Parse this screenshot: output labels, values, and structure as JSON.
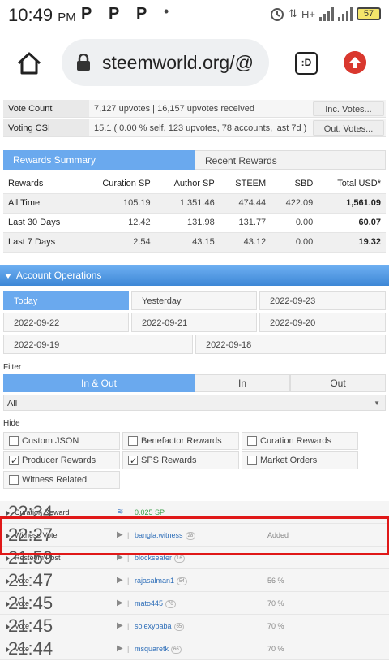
{
  "status_bar": {
    "time": "10:49",
    "ampm": "PM",
    "notif_icons": [
      "P",
      "P",
      "P"
    ],
    "net": "H+",
    "battery": "57"
  },
  "browser": {
    "url": "steemworld.org/@",
    "tabs_label": ":D"
  },
  "vote_count": {
    "label": "Vote Count",
    "value": "7,127 upvotes  |  16,157 upvotes received",
    "button": "Inc. Votes..."
  },
  "voting_csi": {
    "label": "Voting CSI",
    "value": "15.1 ( 0.00 % self, 123 upvotes, 78 accounts, last 7d )",
    "button": "Out. Votes..."
  },
  "rewards_tabs": {
    "summary": "Rewards Summary",
    "recent": "Recent Rewards"
  },
  "rewards_table": {
    "headers": [
      "Rewards",
      "Curation SP",
      "Author SP",
      "STEEM",
      "SBD",
      "Total USD*"
    ],
    "rows": [
      [
        "All Time",
        "105.19",
        "1,351.46",
        "474.44",
        "422.09",
        "1,561.09"
      ],
      [
        "Last 30 Days",
        "12.42",
        "131.98",
        "131.77",
        "0.00",
        "60.07"
      ],
      [
        "Last 7 Days",
        "2.54",
        "43.15",
        "43.12",
        "0.00",
        "19.32"
      ]
    ]
  },
  "account_operations": {
    "title": "Account Operations",
    "dates": [
      "Today",
      "Yesterday",
      "2022-09-23",
      "2022-09-22",
      "2022-09-21",
      "2022-09-20",
      "2022-09-19",
      "2022-09-18"
    ],
    "filter_label": "Filter",
    "filter_tabs": [
      "In & Out",
      "In",
      "Out"
    ],
    "select_value": "All",
    "hide_label": "Hide",
    "hide_options": [
      {
        "label": "Custom JSON",
        "checked": false
      },
      {
        "label": "Benefactor Rewards",
        "checked": false
      },
      {
        "label": "Curation Rewards",
        "checked": false
      },
      {
        "label": "Producer Rewards",
        "checked": true
      },
      {
        "label": "SPS Rewards",
        "checked": true
      },
      {
        "label": "Market Orders",
        "checked": false
      },
      {
        "label": "Witness Related",
        "checked": false
      }
    ],
    "operations": [
      {
        "type": "Curation Reward",
        "user": "",
        "rep": "",
        "value": "0.025 SP",
        "time": "22:34"
      },
      {
        "type": "Witness Vote",
        "user": "bangla.witness",
        "rep": "28",
        "value": "Added",
        "time": "22:27"
      },
      {
        "type": "Resteem Post",
        "user": "blockseater",
        "rep": "16",
        "value": "",
        "time": "21:59"
      },
      {
        "type": "Vote",
        "user": "rajasalman1",
        "rep": "54",
        "value": "56 %",
        "time": "21:47"
      },
      {
        "type": "Vote",
        "user": "mato445",
        "rep": "70",
        "value": "70 %",
        "time": "21:45"
      },
      {
        "type": "Vote",
        "user": "solexybaba",
        "rep": "65",
        "value": "70 %",
        "time": "21:45"
      },
      {
        "type": "Vote",
        "user": "msquaretk",
        "rep": "66",
        "value": "70 %",
        "time": "21:44"
      }
    ]
  }
}
